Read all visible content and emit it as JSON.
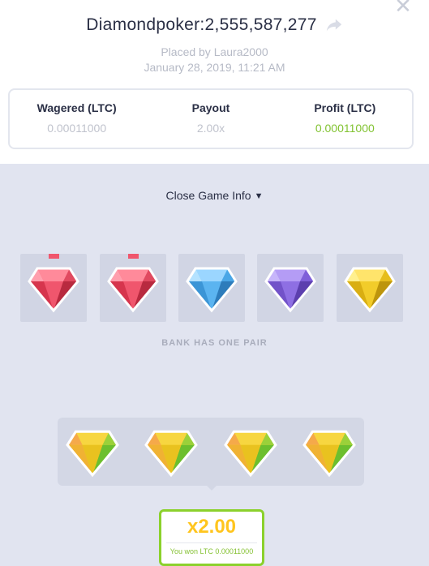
{
  "header": {
    "title": "Diamondpoker:2,555,587,277",
    "placed_by": "Placed by Laura2000",
    "date": "January 28, 2019, 11:21 AM",
    "close_icon": "close-icon",
    "share_icon": "share-icon"
  },
  "stats": {
    "wagered_label": "Wagered (LTC)",
    "wagered_value": "0.00011000",
    "payout_label": "Payout",
    "payout_value": "2.00x",
    "profit_label": "Profit (LTC)",
    "profit_value": "0.00011000",
    "profit_color": "#82c332"
  },
  "toggle": {
    "label": "Close Game Info",
    "icon": "chevron-down-icon"
  },
  "bank": {
    "gems": [
      {
        "color": "red",
        "paired": true
      },
      {
        "color": "red",
        "paired": true
      },
      {
        "color": "blue",
        "paired": false
      },
      {
        "color": "purple",
        "paired": false
      },
      {
        "color": "yellow",
        "paired": false
      }
    ],
    "result_label": "BANK HAS ONE PAIR"
  },
  "player": {
    "gems": [
      "yellow-green",
      "yellow-green",
      "yellow-green",
      "yellow-green"
    ]
  },
  "win": {
    "multiplier": "x2.00",
    "text": "You won LTC 0.00011000",
    "border_color": "#8bd12c"
  },
  "colors": {
    "red": "#f0566d",
    "blue": "#5bb4f0",
    "purple": "#8e6fe3",
    "yellow": "#f2cc2a"
  }
}
